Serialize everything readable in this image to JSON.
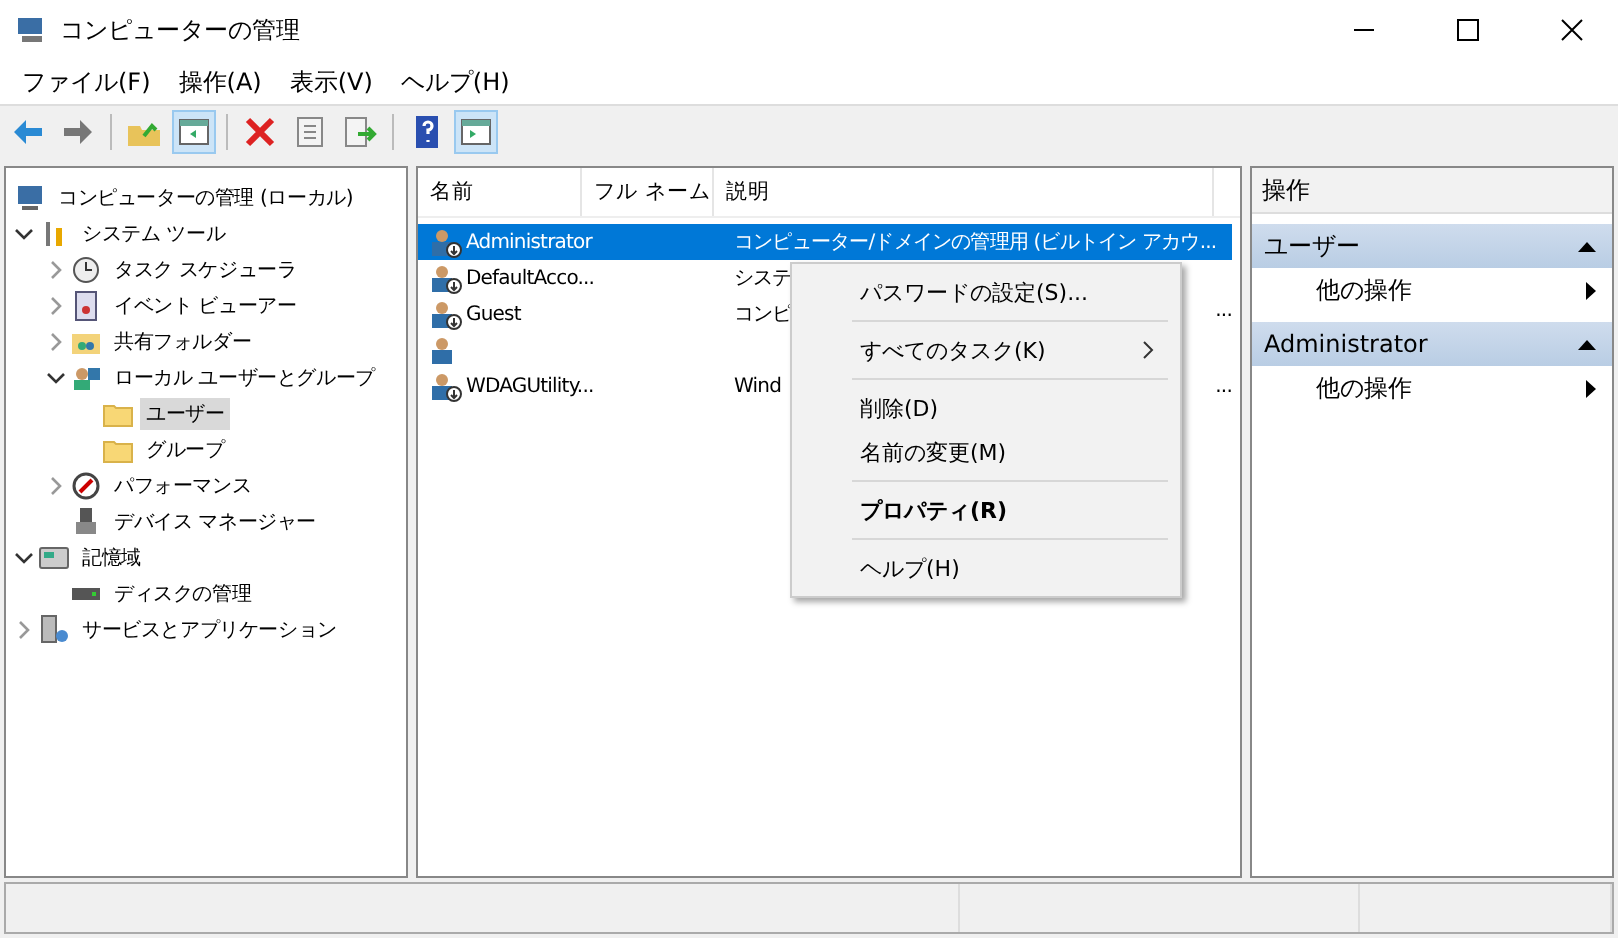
{
  "window": {
    "title": "コンピューターの管理"
  },
  "menu_bar": [
    "ファイル(F)",
    "操作(A)",
    "表示(V)",
    "ヘルプ(H)"
  ],
  "toolbar": [
    {
      "kind": "back",
      "pressed": false
    },
    {
      "kind": "forward",
      "pressed": false
    },
    {
      "kind": "sep"
    },
    {
      "kind": "up",
      "pressed": false
    },
    {
      "kind": "tree",
      "pressed": true
    },
    {
      "kind": "sep"
    },
    {
      "kind": "delete",
      "pressed": false
    },
    {
      "kind": "properties",
      "pressed": false
    },
    {
      "kind": "export",
      "pressed": false
    },
    {
      "kind": "sep"
    },
    {
      "kind": "help",
      "pressed": false
    },
    {
      "kind": "actions",
      "pressed": true
    }
  ],
  "tree": [
    {
      "label": "コンピューターの管理 (ローカル)",
      "kind": "computer",
      "selected": false,
      "children": [
        {
          "label": "システム ツール",
          "kind": "tools",
          "expanded": true,
          "selected": false,
          "children": [
            {
              "label": "タスク スケジューラ",
              "kind": "clock",
              "expanded": false,
              "selected": false
            },
            {
              "label": "イベント ビューアー",
              "kind": "log",
              "expanded": false,
              "selected": false
            },
            {
              "label": "共有フォルダー",
              "kind": "share",
              "expanded": false,
              "selected": false
            },
            {
              "label": "ローカル ユーザーとグループ",
              "kind": "users",
              "expanded": true,
              "selected": false,
              "children": [
                {
                  "label": "ユーザー",
                  "kind": "folder",
                  "selected": true
                },
                {
                  "label": "グループ",
                  "kind": "folder",
                  "selected": false
                }
              ]
            },
            {
              "label": "パフォーマンス",
              "kind": "perf",
              "expanded": false,
              "selected": false
            },
            {
              "label": "デバイス マネージャー",
              "kind": "device",
              "selected": false
            }
          ]
        },
        {
          "label": "記憶域",
          "kind": "storage",
          "expanded": true,
          "selected": false,
          "children": [
            {
              "label": "ディスクの管理",
              "kind": "disk",
              "selected": false
            }
          ]
        },
        {
          "label": "サービスとアプリケーション",
          "kind": "services",
          "expanded": false,
          "selected": false
        }
      ]
    }
  ],
  "table": {
    "columns": [
      "名前",
      "フル ネーム",
      "説明"
    ],
    "rows": [
      {
        "name": "Administrator",
        "description": "コンピューター/ドメインの管理用 (ビルトイン アカウ...",
        "selected": true,
        "disabled": true
      },
      {
        "name": "DefaultAcco...",
        "description": "システ",
        "selected": false,
        "disabled": true
      },
      {
        "name": "Guest",
        "description": "コンピ",
        "description_tail": "...",
        "selected": false,
        "disabled": true
      },
      {
        "selected": false,
        "disabled": false
      },
      {
        "name": "WDAGUtility...",
        "description": "Wind",
        "description_tail": "...",
        "selected": false,
        "disabled": true
      }
    ]
  },
  "context_menu": {
    "groups": [
      [
        {
          "label": "パスワードの設定(S)...",
          "bold": false,
          "submenu": false
        }
      ],
      [
        {
          "label": "すべてのタスク(K)",
          "bold": false,
          "submenu": true
        }
      ],
      [
        {
          "label": "削除(D)",
          "bold": false,
          "submenu": false
        },
        {
          "label": "名前の変更(M)",
          "bold": false,
          "submenu": false
        }
      ],
      [
        {
          "label": "プロパティ(R)",
          "bold": true,
          "submenu": false
        }
      ],
      [
        {
          "label": "ヘルプ(H)",
          "bold": false,
          "submenu": false
        }
      ]
    ]
  },
  "actions_pane": {
    "title": "操作",
    "sections": [
      {
        "title": "ユーザー",
        "expanded": true,
        "items": [
          "他の操作"
        ]
      },
      {
        "title": "Administrator",
        "expanded": true,
        "items": [
          "他の操作"
        ]
      }
    ]
  }
}
